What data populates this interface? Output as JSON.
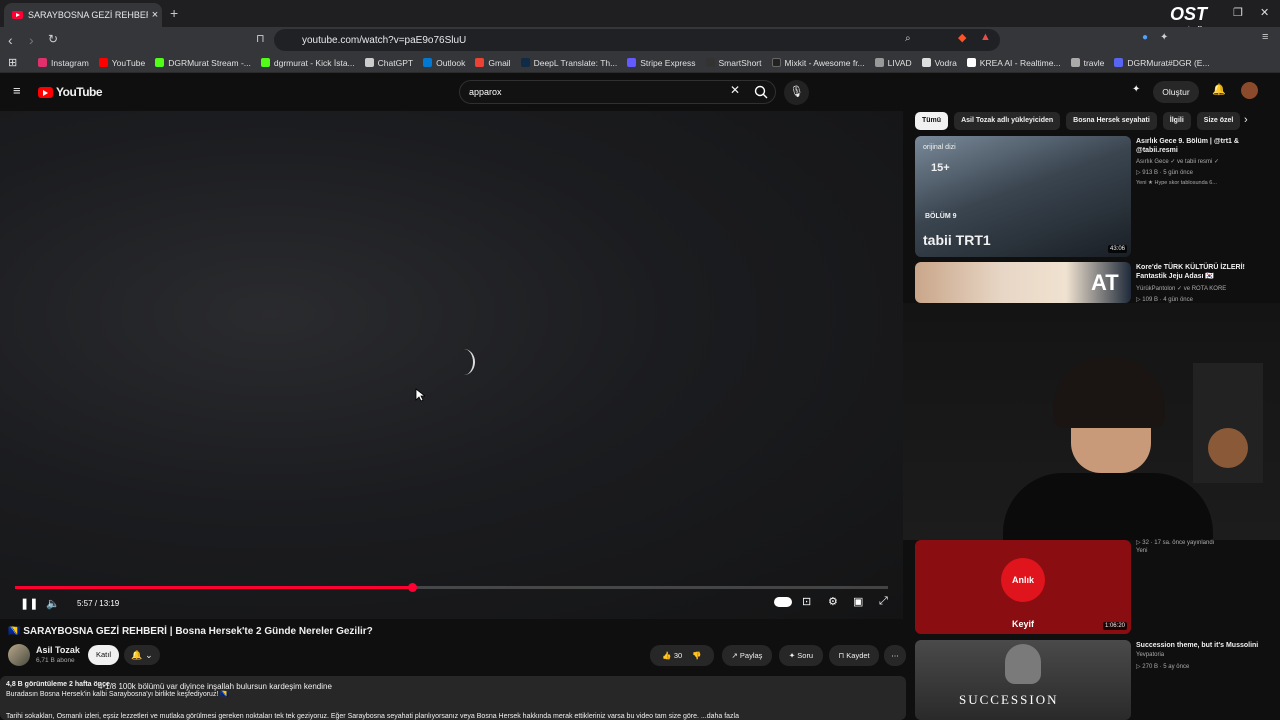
{
  "browser": {
    "tab_title": "SARAYBOSNA GEZİ REHBERİ",
    "tab_close": "×",
    "new_tab": "+",
    "url": "youtube.com/watch?v=paE9o76SluU"
  },
  "bookmarks": [
    {
      "label": "Instagram",
      "color": "#e1306c"
    },
    {
      "label": "YouTube",
      "color": "#ff0000"
    },
    {
      "label": "DGRMurat Stream -...",
      "color": "#53fc18"
    },
    {
      "label": "dgrmurat - Kick İsta...",
      "color": "#53fc18"
    },
    {
      "label": "ChatGPT",
      "color": "#cccccc"
    },
    {
      "label": "Outlook",
      "color": "#0078d4"
    },
    {
      "label": "Gmail",
      "color": "#ea4335"
    },
    {
      "label": "DeepL Translate: Th...",
      "color": "#0f2b46"
    },
    {
      "label": "Stripe Express",
      "color": "#635bff"
    },
    {
      "label": "SmartShort",
      "color": "#333333"
    },
    {
      "label": "Mixkit - Awesome fr...",
      "color": "#222222"
    },
    {
      "label": "LIVAD",
      "color": "#999999"
    },
    {
      "label": "Vodra",
      "color": "#dddddd"
    },
    {
      "label": "KREA AI - Realtime...",
      "color": "#ffffff"
    },
    {
      "label": "travle",
      "color": "#aaaaaa"
    },
    {
      "label": "DGRMurat#DGR (E...",
      "color": "#5865f2"
    }
  ],
  "youtube": {
    "logo": "YouTube",
    "search_value": "apparox",
    "create_label": "Oluştur"
  },
  "player": {
    "progress_fraction": 0.455,
    "time": "5:57 / 13:19"
  },
  "video": {
    "title": "SARAYBOSNA GEZİ REHBERİ | Bosna Hersek'te 2 Günde Nereler Gezilir?",
    "channel": "Asil Tozak",
    "subscribers": "6,71 B abone",
    "join": "Katıl",
    "likes": "30",
    "share": "Paylaş",
    "ask": "Soru",
    "save": "Kaydet"
  },
  "description": {
    "line1": "4,8 B görüntüleme  2 hafta önce",
    "line2": "Buradasın Bosna Hersek'in kalbi Saraybosna'yı birlikte keşfediyoruz! 🇧🇦",
    "line3": "Tarihi sokakları, Osmanlı izleri, eşsiz lezzetleri ve mutlaka görülmesi gereken noktaları tek tek geziyoruz. Eğer Saraybosna seyahati planlıyorsanız veya Bosna Hersek hakkında merak ettikleriniz varsa bu video tam size göre. ...daha fazla",
    "overlay": "4-1/8 100k bölümü var diyince inşallah bulursun kardeşim kendine"
  },
  "chips": [
    "Tümü",
    "Asil Tozak adlı yükleyiciden",
    "Bosna Hersek seyahati",
    "İlgili",
    "Size özel"
  ],
  "recommendations": [
    {
      "title": "Asırlık Gece 9. Bölüm | @trt1 & @tabii.resmi",
      "channel": "Asırlık Gece ✓ ve tabii resmi ✓",
      "meta": "▷ 913 B · 5 gün önce",
      "badge": "Yeni  ★ Hype skor tablosunda 6...",
      "duration": "43:06",
      "thumb_text": "orijinal dizi",
      "thumb_sub": "BÖLÜM 9",
      "thumb_brand": "tabii TRT1",
      "thumb_age": "15+"
    },
    {
      "title": "Kore'de TÜRK KÜLTÜRÜ İZLERİ! Fantastik Jeju Adası 🇰🇷",
      "channel": "YürükPantolon ✓ ve ROTA KORE",
      "meta": "▷ 109 B · 4 gün önce",
      "badge": "",
      "duration": "",
      "thumb_text": "AT"
    },
    {
      "title": "",
      "channel": "",
      "meta": "▷ 32 · 17 sa. önce yayınlandı",
      "badge": "Yeni",
      "duration": "1:06:20",
      "thumb_text": "Anlık Keyif"
    },
    {
      "title": "Succession theme, but it's Mussolini",
      "channel": "Yevpatoria",
      "meta": "▷ 270 B · 5 ay önce",
      "badge": "",
      "duration": "",
      "thumb_text": "SUCCESSION"
    }
  ],
  "watermark": {
    "main": "OST",
    "sub": "studio"
  }
}
